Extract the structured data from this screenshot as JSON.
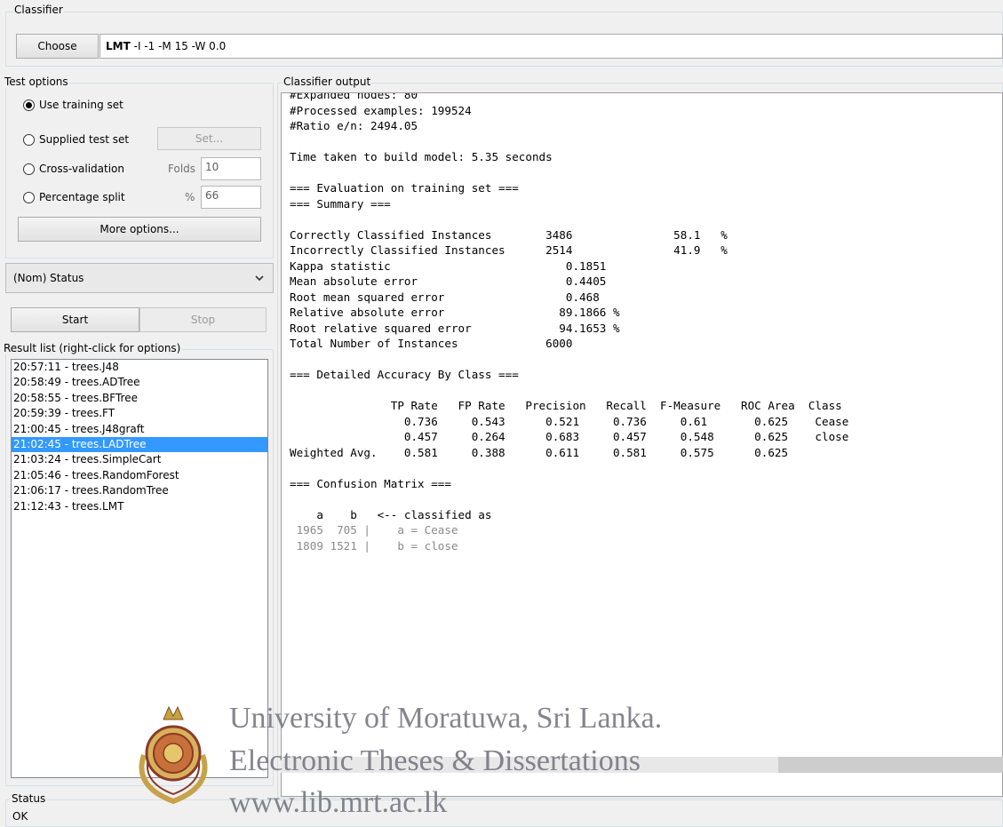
{
  "classifier": {
    "group_label": "Classifier",
    "choose_button": "Choose",
    "name": "LMT",
    "options": "-I -1 -M 15 -W 0.0"
  },
  "test_options": {
    "group_label": "Test options",
    "use_training_set": "Use training set",
    "supplied_test_set": "Supplied test set",
    "set_button": "Set...",
    "cross_validation": "Cross-validation",
    "folds_label": "Folds",
    "folds_value": "10",
    "percentage_split": "Percentage split",
    "percent_label": "%",
    "percent_value": "66",
    "more_options_button": "More options...",
    "selected": "use_training_set"
  },
  "class_attribute": {
    "value": "(Nom) Status"
  },
  "run": {
    "start_button": "Start",
    "stop_button": "Stop"
  },
  "result_list": {
    "label": "Result list (right-click for options)",
    "items": [
      "20:57:11 - trees.J48",
      "20:58:49 - trees.ADTree",
      "20:58:55 - trees.BFTree",
      "20:59:39 - trees.FT",
      "21:00:45 - trees.J48graft",
      "21:02:45 - trees.LADTree",
      "21:03:24 - trees.SimpleCart",
      "21:05:46 - trees.RandomForest",
      "21:06:17 - trees.RandomTree",
      "21:12:43 - trees.LMT"
    ],
    "selected_index": 5
  },
  "output": {
    "label": "Classifier output",
    "lines": [
      "#Expanded nodes: 80",
      "#Processed examples: 199524",
      "#Ratio e/n: 2494.05",
      "",
      "Time taken to build model: 5.35 seconds",
      "",
      "=== Evaluation on training set ===",
      "=== Summary ===",
      "",
      "Correctly Classified Instances        3486               58.1   %",
      "Incorrectly Classified Instances      2514               41.9   %",
      "Kappa statistic                          0.1851",
      "Mean absolute error                      0.4405",
      "Root mean squared error                  0.468",
      "Relative absolute error                 89.1866 %",
      "Root relative squared error             94.1653 %",
      "Total Number of Instances             6000",
      "",
      "=== Detailed Accuracy By Class ===",
      "",
      "               TP Rate   FP Rate   Precision   Recall  F-Measure   ROC Area  Class",
      "                 0.736     0.543      0.521     0.736     0.61       0.625    Cease",
      "                 0.457     0.264      0.683     0.457     0.548      0.625    close",
      "Weighted Avg.    0.581     0.388      0.611     0.581     0.575      0.625",
      "",
      "=== Confusion Matrix ===",
      "",
      "    a    b   <-- classified as",
      " 1965  705 |    a = Cease",
      " 1809 1521 |    b = close"
    ]
  },
  "status": {
    "label": "Status",
    "value": "OK"
  },
  "watermark": {
    "line1": "University of Moratuwa, Sri Lanka.",
    "line2": "Electronic Theses & Dissertations",
    "line3": "www.lib.mrt.ac.lk"
  }
}
